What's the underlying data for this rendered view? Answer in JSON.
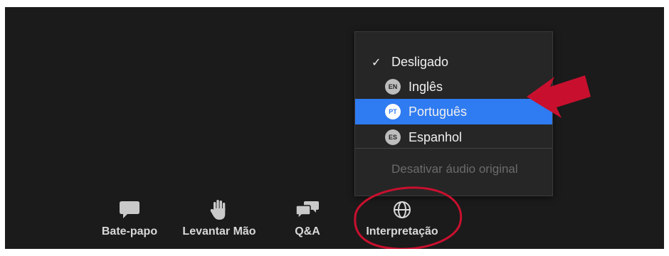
{
  "menu": {
    "items": [
      {
        "label": "Desligado",
        "checked": true,
        "badge": ""
      },
      {
        "label": "Inglês",
        "checked": false,
        "badge": "EN"
      },
      {
        "label": "Português",
        "checked": false,
        "badge": "PT",
        "selected": true
      },
      {
        "label": "Espanhol",
        "checked": false,
        "badge": "ES"
      }
    ],
    "check_glyph": "✓",
    "disabled_option": "Desativar áudio original"
  },
  "toolbar": {
    "chat_label": "Bate-papo",
    "raise_hand_label": "Levantar Mão",
    "qa_label": "Q&A",
    "interpretation_label": "Interpretação"
  },
  "colors": {
    "background": "#1b1b1b",
    "menu_bg": "#262626",
    "selected": "#2f7bf1",
    "annotation_red": "#c8102e"
  },
  "icons": {
    "chat": "chat-bubble-icon",
    "raise_hand": "hand-icon",
    "qa": "qa-bubbles-icon",
    "interpretation": "globe-icon",
    "annotation_arrow": "red-arrow-icon"
  }
}
